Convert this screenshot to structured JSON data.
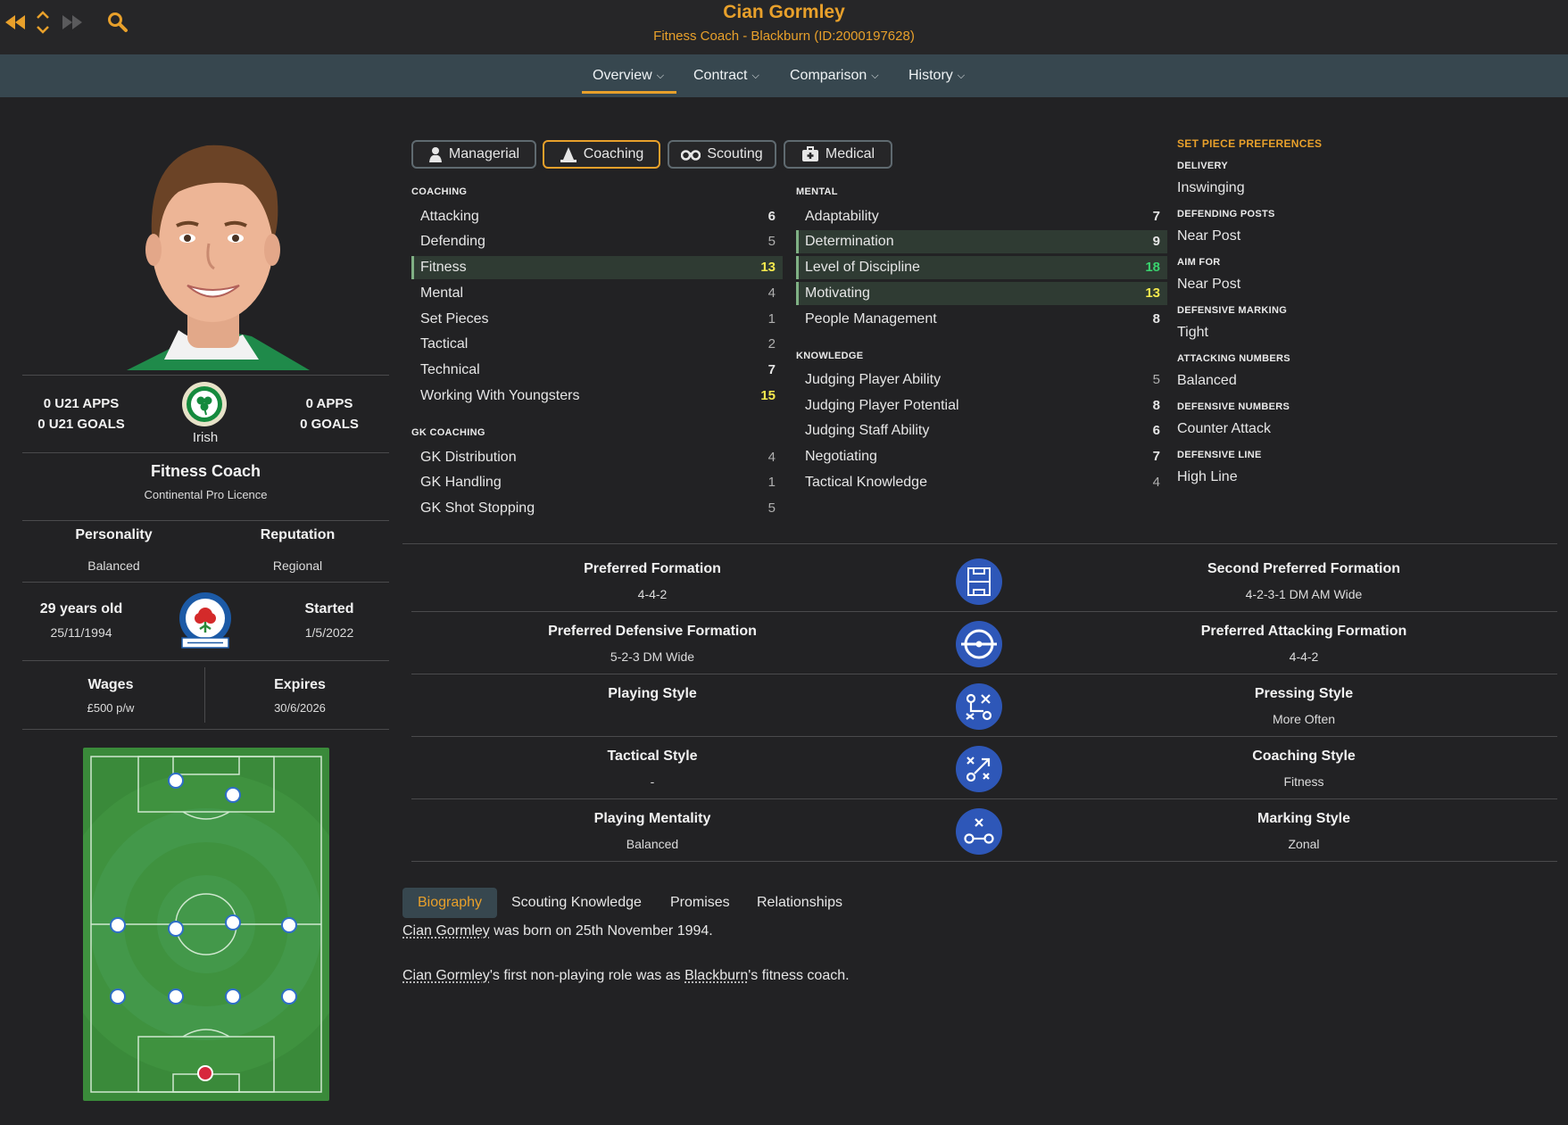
{
  "header": {
    "name": "Cian Gormley",
    "subtitle": "Fitness Coach - Blackburn (ID:2000197628)",
    "accent_color": "#e8a02b",
    "nav_icons": [
      "back-arrow-icon",
      "up-down-arrows-icon",
      "forward-arrow-icon",
      "search-icon"
    ]
  },
  "menu": {
    "items": [
      {
        "label": "Overview",
        "active": true
      },
      {
        "label": "Contract",
        "active": false
      },
      {
        "label": "Comparison",
        "active": false
      },
      {
        "label": "History",
        "active": false
      }
    ]
  },
  "profile": {
    "u21_apps": "0 U21 APPS",
    "u21_goals": "0 U21 GOALS",
    "apps": "0 APPS",
    "goals": "0 GOALS",
    "nationality": "Irish",
    "role": "Fitness Coach",
    "licence": "Continental Pro Licence",
    "personality_label": "Personality",
    "personality": "Balanced",
    "reputation_label": "Reputation",
    "reputation": "Regional",
    "age": "29 years old",
    "dob": "25/11/1994",
    "started_label": "Started",
    "started": "1/5/2022",
    "wages_label": "Wages",
    "wages": "£500 p/w",
    "expires_label": "Expires",
    "expires": "30/6/2026"
  },
  "tabs": [
    {
      "label": "Managerial",
      "icon": "manager-icon",
      "active": false
    },
    {
      "label": "Coaching",
      "icon": "cone-icon",
      "active": true
    },
    {
      "label": "Scouting",
      "icon": "binoculars-icon",
      "active": false
    },
    {
      "label": "Medical",
      "icon": "medical-kit-icon",
      "active": false
    }
  ],
  "coaching": {
    "title": "COACHING",
    "rows": [
      {
        "label": "Attacking",
        "value": "6"
      },
      {
        "label": "Defending",
        "value": "5"
      },
      {
        "label": "Fitness",
        "value": "13"
      },
      {
        "label": "Mental",
        "value": "4"
      },
      {
        "label": "Set Pieces",
        "value": "1"
      },
      {
        "label": "Tactical",
        "value": "2"
      },
      {
        "label": "Technical",
        "value": "7"
      },
      {
        "label": "Working With Youngsters",
        "value": "15"
      }
    ]
  },
  "gk_coaching": {
    "title": "GK COACHING",
    "rows": [
      {
        "label": "GK Distribution",
        "value": "4"
      },
      {
        "label": "GK Handling",
        "value": "1"
      },
      {
        "label": "GK Shot Stopping",
        "value": "5"
      }
    ]
  },
  "mental": {
    "title": "MENTAL",
    "rows": [
      {
        "label": "Adaptability",
        "value": "7"
      },
      {
        "label": "Determination",
        "value": "9"
      },
      {
        "label": "Level of Discipline",
        "value": "18"
      },
      {
        "label": "Motivating",
        "value": "13"
      },
      {
        "label": "People Management",
        "value": "8"
      }
    ]
  },
  "knowledge": {
    "title": "KNOWLEDGE",
    "rows": [
      {
        "label": "Judging Player Ability",
        "value": "5"
      },
      {
        "label": "Judging Player Potential",
        "value": "8"
      },
      {
        "label": "Judging Staff Ability",
        "value": "6"
      },
      {
        "label": "Negotiating",
        "value": "7"
      },
      {
        "label": "Tactical Knowledge",
        "value": "4"
      }
    ]
  },
  "set_pieces": {
    "title": "SET PIECE PREFERENCES",
    "items": [
      {
        "label": "DELIVERY",
        "value": "Inswinging"
      },
      {
        "label": "DEFENDING POSTS",
        "value": "Near Post"
      },
      {
        "label": "AIM FOR",
        "value": "Near Post"
      },
      {
        "label": "DEFENSIVE MARKING",
        "value": "Tight"
      },
      {
        "label": "ATTACKING NUMBERS",
        "value": "Balanced"
      },
      {
        "label": "DEFENSIVE NUMBERS",
        "value": "Counter Attack"
      },
      {
        "label": "DEFENSIVE LINE",
        "value": "High Line"
      }
    ]
  },
  "formations": [
    {
      "left_label": "Preferred Formation",
      "left_value": "4-4-2",
      "icon": "pitch-icon",
      "right_label": "Second Preferred Formation",
      "right_value": "4-2-3-1 DM AM Wide"
    },
    {
      "left_label": "Preferred Defensive Formation",
      "left_value": "5-2-3 DM Wide",
      "icon": "center-circle-icon",
      "right_label": "Preferred Attacking Formation",
      "right_value": "4-4-2"
    },
    {
      "left_label": "Playing Style",
      "left_value": "",
      "icon": "tactic-arrows-icon",
      "right_label": "Pressing Style",
      "right_value": "More Often"
    },
    {
      "left_label": "Tactical Style",
      "left_value": "-",
      "icon": "tactic-board-icon",
      "right_label": "Coaching Style",
      "right_value": "Fitness"
    },
    {
      "left_label": "Playing Mentality",
      "left_value": "Balanced",
      "icon": "marking-icon",
      "right_label": "Marking Style",
      "right_value": "Zonal"
    }
  ],
  "bottom_tabs": [
    {
      "label": "Biography",
      "active": true
    },
    {
      "label": "Scouting Knowledge",
      "active": false
    },
    {
      "label": "Promises",
      "active": false
    },
    {
      "label": "Relationships",
      "active": false
    }
  ],
  "biography": {
    "line1_name": "Cian Gormley",
    "line1_rest": " was born on 25th November 1994.",
    "line2_name": "Cian Gormley",
    "line2_mid": "'s first non-playing role was as ",
    "line2_club": "Blackburn",
    "line2_end": "'s fitness coach."
  }
}
